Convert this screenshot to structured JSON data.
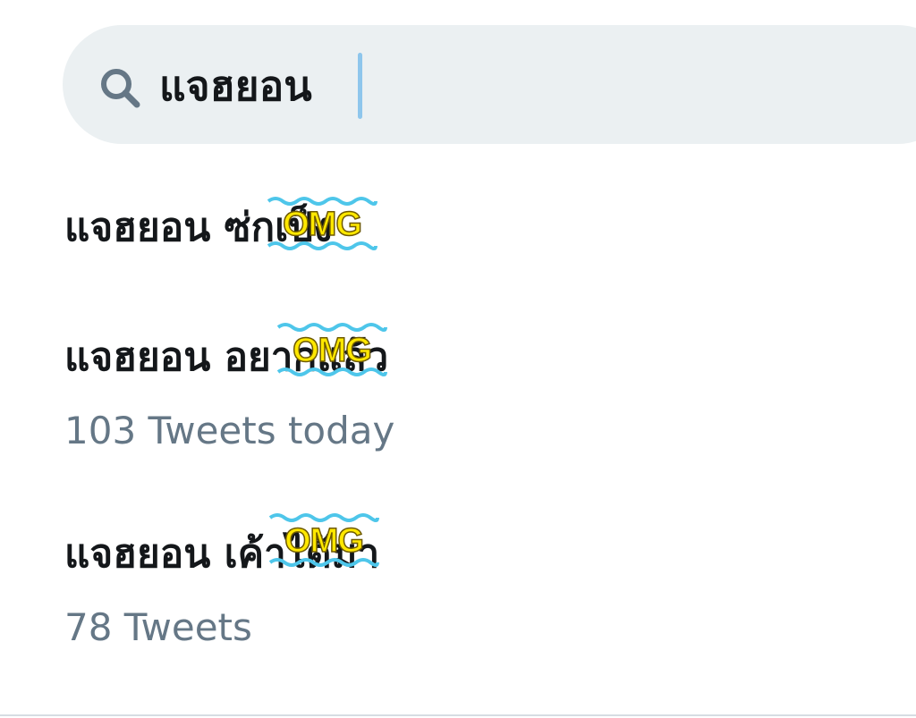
{
  "search": {
    "query": "แจฮยอน"
  },
  "suggestions": [
    {
      "title": "แจฮยอน ซ่กเป็ง",
      "meta": ""
    },
    {
      "title": "แจฮยอน อยากแล้ว",
      "meta": "103 Tweets today"
    },
    {
      "title": "แจฮยอน เค้าได้มา",
      "meta": "78 Tweets"
    }
  ],
  "stickers": {
    "text": "OMG"
  },
  "colors": {
    "search_bg": "#ebf0f2",
    "caret": "#8ec6ec",
    "primary_text": "#14171a",
    "secondary_text": "#657786",
    "omg_yellow": "#ffe800",
    "wave_blue": "#4ec6ea"
  }
}
